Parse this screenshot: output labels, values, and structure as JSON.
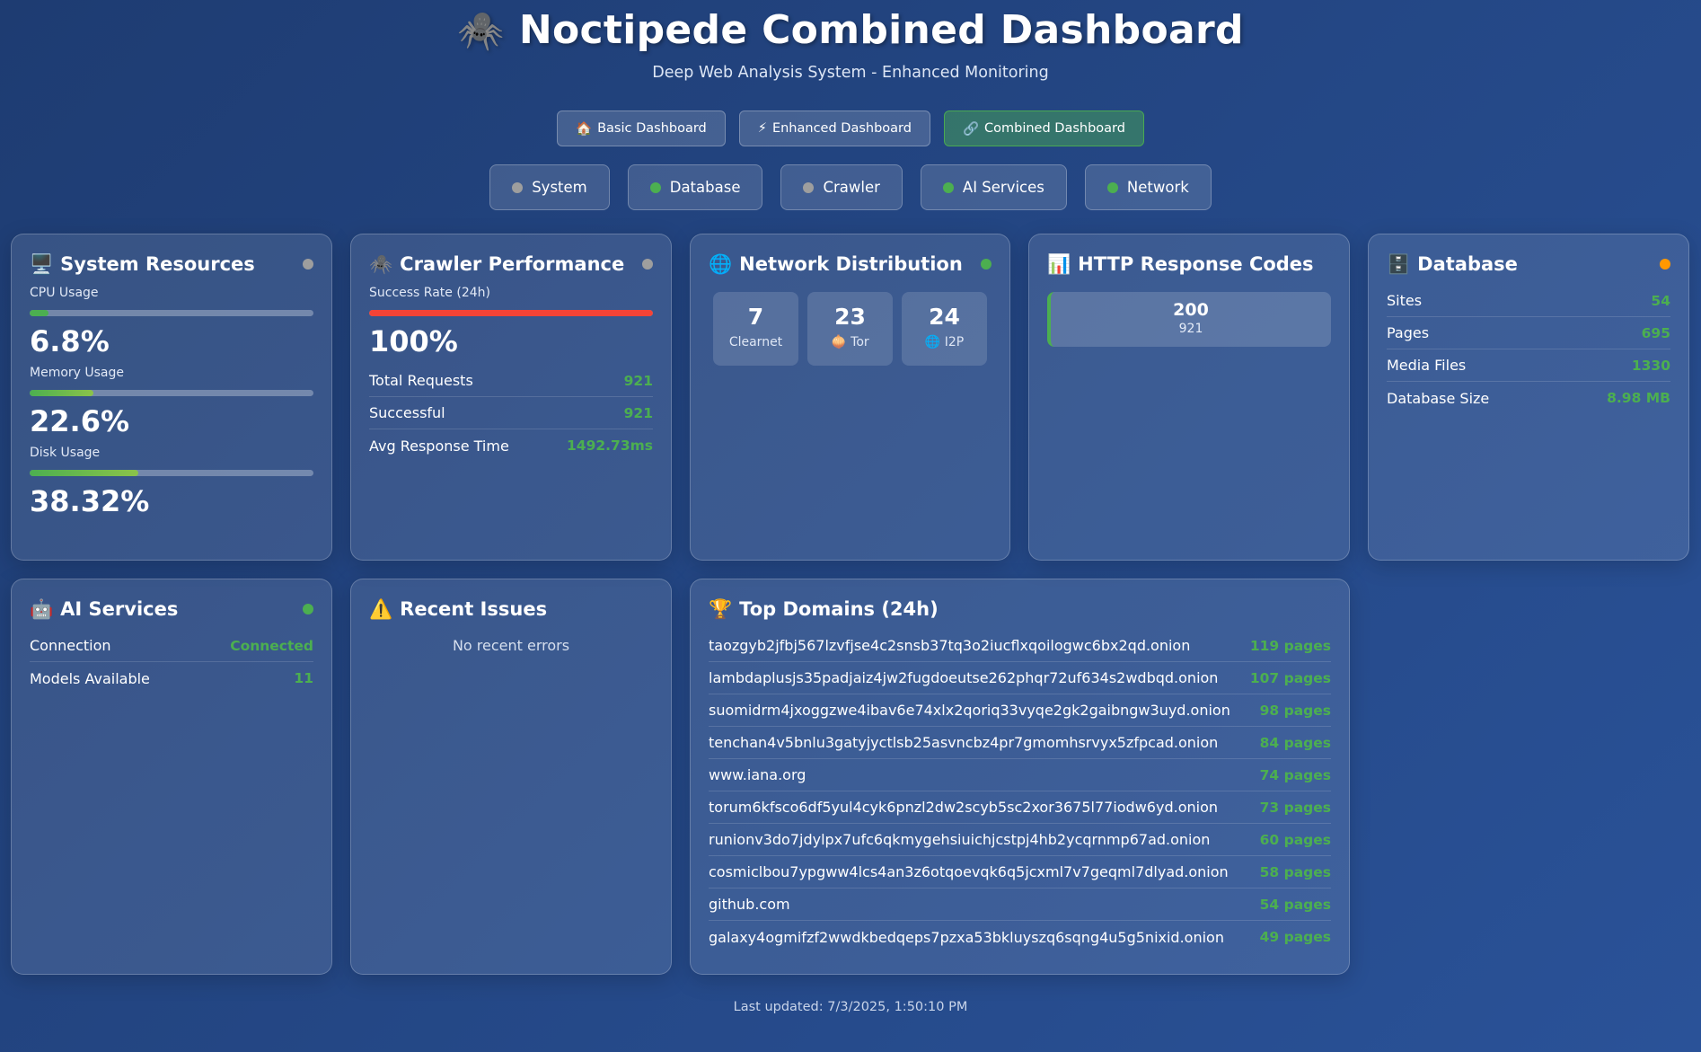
{
  "header": {
    "icon": "🕷️",
    "title": "Noctipede Combined Dashboard",
    "subtitle": "Deep Web Analysis System - Enhanced Monitoring"
  },
  "nav": [
    {
      "icon": "🏠",
      "label": "Basic Dashboard",
      "active": false
    },
    {
      "icon": "⚡",
      "label": "Enhanced Dashboard",
      "active": false
    },
    {
      "icon": "🔗",
      "label": "Combined Dashboard",
      "active": true
    }
  ],
  "status": [
    {
      "label": "System",
      "color": "#9e9e9e"
    },
    {
      "label": "Database",
      "color": "#4caf50"
    },
    {
      "label": "Crawler",
      "color": "#9e9e9e"
    },
    {
      "label": "AI Services",
      "color": "#4caf50"
    },
    {
      "label": "Network",
      "color": "#4caf50"
    }
  ],
  "system": {
    "icon": "🖥️",
    "title": "System Resources",
    "status_color": "#9e9e9e",
    "cpu": {
      "label": "CPU Usage",
      "value": "6.8%",
      "percent": 6.8
    },
    "memory": {
      "label": "Memory Usage",
      "value": "22.6%",
      "percent": 22.6
    },
    "disk": {
      "label": "Disk Usage",
      "value": "38.32%",
      "percent": 38.32
    }
  },
  "crawler": {
    "icon": "🕷️",
    "title": "Crawler Performance",
    "status_color": "#9e9e9e",
    "success_label": "Success Rate (24h)",
    "success_value": "100%",
    "success_percent": 100,
    "rows": [
      {
        "label": "Total Requests",
        "value": "921"
      },
      {
        "label": "Successful",
        "value": "921"
      },
      {
        "label": "Avg Response Time",
        "value": "1492.73ms"
      }
    ]
  },
  "network": {
    "icon": "🌐",
    "title": "Network Distribution",
    "status_color": "#4caf50",
    "items": [
      {
        "count": "7",
        "label": "Clearnet"
      },
      {
        "count": "23",
        "label": "🧅 Tor"
      },
      {
        "count": "24",
        "label": "🌐 I2P"
      }
    ]
  },
  "http": {
    "icon": "📊",
    "title": "HTTP Response Codes",
    "codes": [
      {
        "code": "200",
        "count": "921"
      }
    ]
  },
  "database": {
    "icon": "🗄️",
    "title": "Database",
    "status_color": "#ff9800",
    "rows": [
      {
        "label": "Sites",
        "value": "54"
      },
      {
        "label": "Pages",
        "value": "695"
      },
      {
        "label": "Media Files",
        "value": "1330"
      },
      {
        "label": "Database Size",
        "value": "8.98 MB"
      }
    ]
  },
  "ai": {
    "icon": "🤖",
    "title": "AI Services",
    "status_color": "#4caf50",
    "rows": [
      {
        "label": "Connection",
        "value": "Connected"
      },
      {
        "label": "Models Available",
        "value": "11"
      }
    ]
  },
  "issues": {
    "icon": "⚠️",
    "title": "Recent Issues",
    "empty_text": "No recent errors"
  },
  "domains": {
    "icon": "🏆",
    "title": "Top Domains (24h)",
    "rows": [
      {
        "label": "taozgyb2jfbj567lzvfjse4c2snsb37tq3o2iucflxqoilogwc6bx2qd.onion",
        "value": "119 pages"
      },
      {
        "label": "lambdaplusjs35padjaiz4jw2fugdoeutse262phqr72uf634s2wdbqd.onion",
        "value": "107 pages"
      },
      {
        "label": "suomidrm4jxoggzwe4ibav6e74xlx2qoriq33vyqe2gk2gaibngw3uyd.onion",
        "value": "98 pages"
      },
      {
        "label": "tenchan4v5bnlu3gatyjyctlsb25asvncbz4pr7gmomhsrvyx5zfpcad.onion",
        "value": "84 pages"
      },
      {
        "label": "www.iana.org",
        "value": "74 pages"
      },
      {
        "label": "torum6kfsco6df5yul4cyk6pnzl2dw2scyb5sc2xor3675l77iodw6yd.onion",
        "value": "73 pages"
      },
      {
        "label": "runionv3do7jdylpx7ufc6qkmygehsiuichjcstpj4hb2ycqrnmp67ad.onion",
        "value": "60 pages"
      },
      {
        "label": "cosmiclbou7ypgww4lcs4an3z6otqoevqk6q5jcxml7v7geqml7dlyad.onion",
        "value": "58 pages"
      },
      {
        "label": "github.com",
        "value": "54 pages"
      },
      {
        "label": "galaxy4ogmifzf2wwdkbedqeps7pzxa53bkluyszq6sqng4u5g5nixid.onion",
        "value": "49 pages"
      }
    ]
  },
  "footer": {
    "text": "Last updated: 7/3/2025, 1:50:10 PM"
  }
}
